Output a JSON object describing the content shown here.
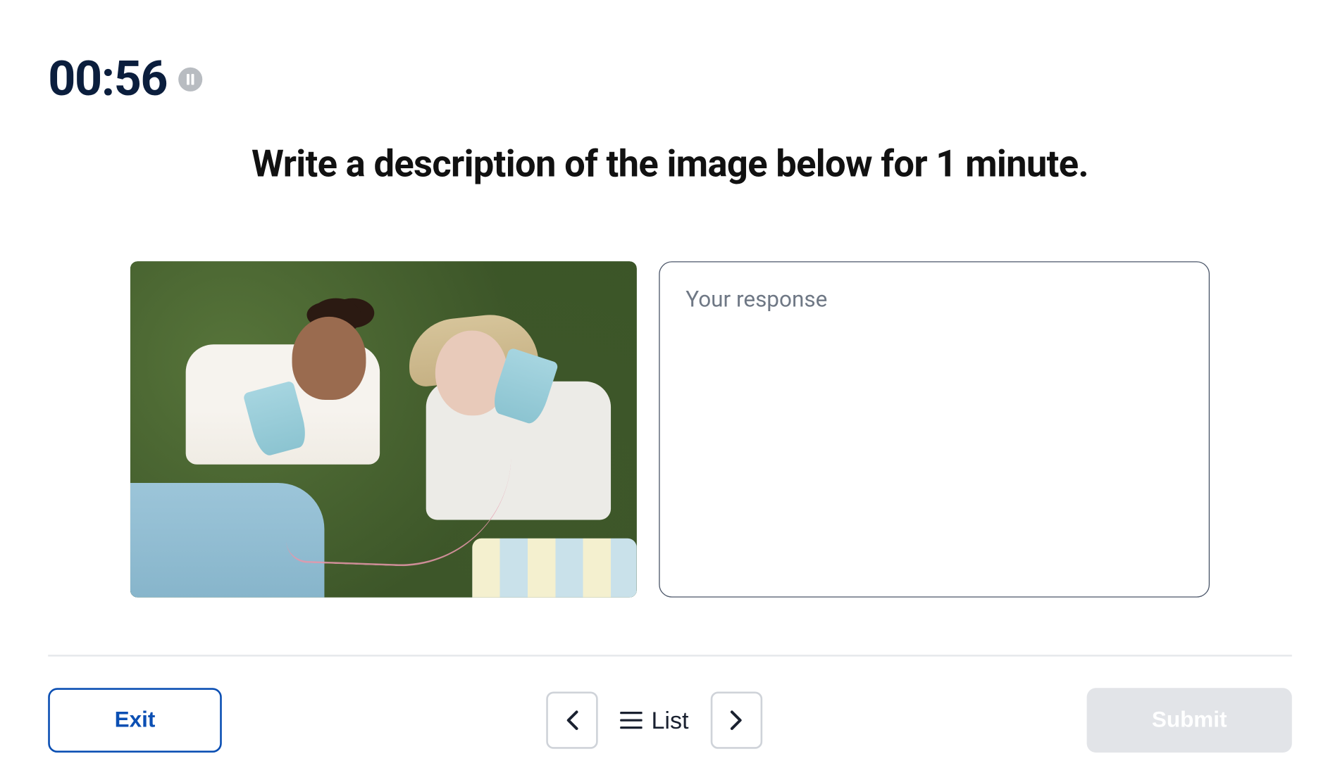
{
  "timer": {
    "display": "00:56"
  },
  "prompt": "Write a description of the image below for 1 minute.",
  "response": {
    "placeholder": "Your response",
    "value": ""
  },
  "footer": {
    "exit_label": "Exit",
    "list_label": "List",
    "submit_label": "Submit"
  }
}
